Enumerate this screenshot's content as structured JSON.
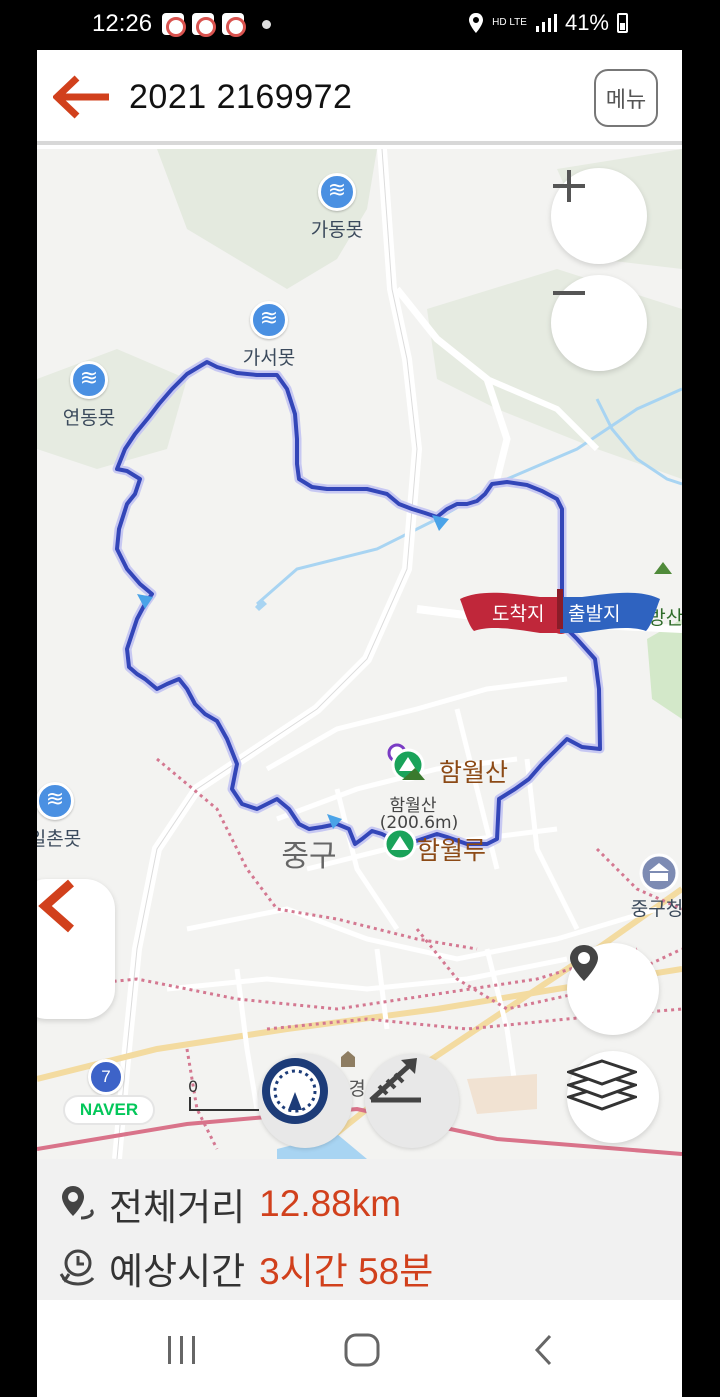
{
  "status_bar": {
    "time": "12:26",
    "network": "HD LTE",
    "battery": "41%"
  },
  "header": {
    "title": "2021 2169972",
    "menu_label": "메뉴"
  },
  "map": {
    "places": {
      "gadongmot": "가동못",
      "gaseomot": "가서못",
      "yeondongmot": "연동못",
      "ilchonmot": "일촌못",
      "hwangbangsan": "황방산",
      "hamwolsan": "함월산",
      "hamwolsan_small": "함월산",
      "hamwolsan_elev": "(200.6m)",
      "hamwollu": "함월루",
      "junggu": "중구",
      "junggucheong": "중구청",
      "gyeong": "경"
    },
    "flags": {
      "arrive": "도착지",
      "depart": "출발지"
    },
    "road_badge": "7",
    "naver_logo": "NAVER",
    "scale_label": "0"
  },
  "route": {
    "distance_label": "전체거리",
    "distance_value": "12.88km",
    "time_label": "예상시간",
    "time_value": "3시간 58분"
  },
  "colors": {
    "accent": "#d1401c",
    "route": "#3346b8",
    "flag_red": "#c0273a",
    "flag_blue": "#2f63c0"
  }
}
